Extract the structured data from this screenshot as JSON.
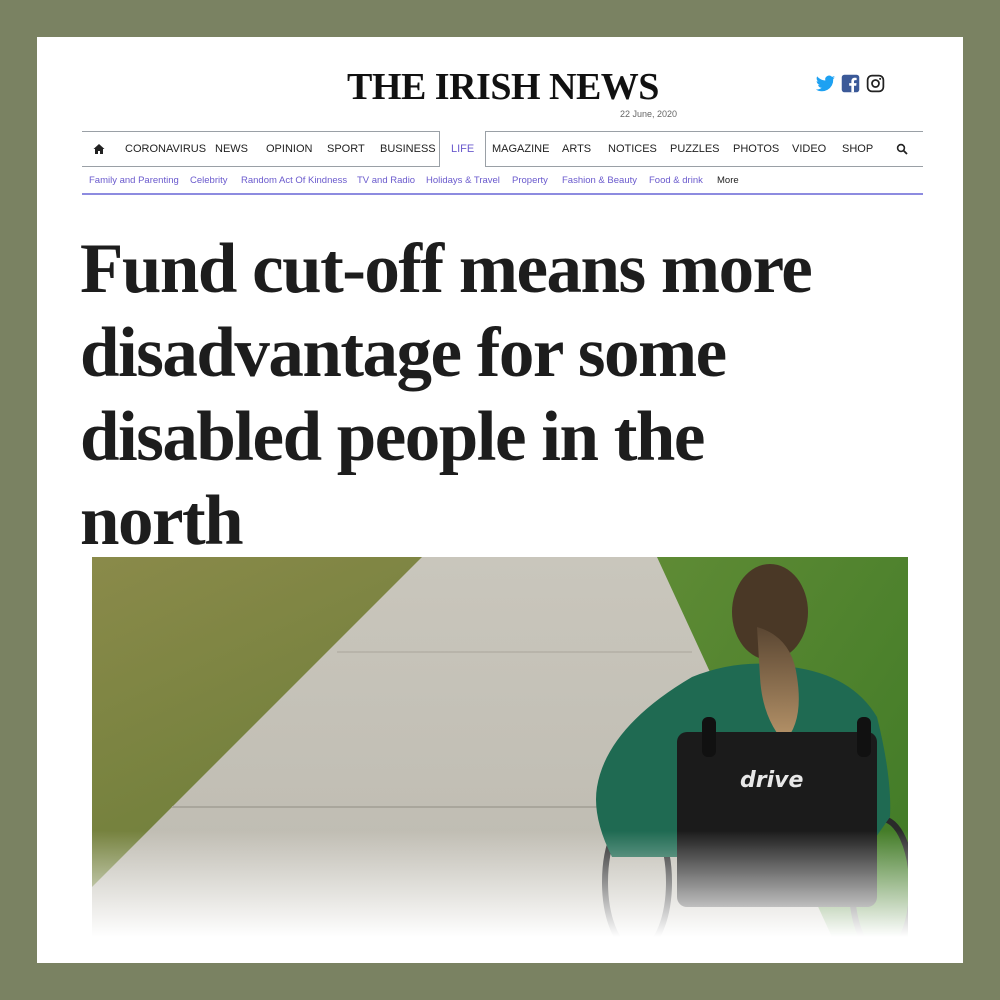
{
  "site": {
    "name": "THE IRISH NEWS",
    "date": "22 June, 2020"
  },
  "social": [
    "twitter-icon",
    "facebook-icon",
    "instagram-icon"
  ],
  "main_nav": {
    "items": [
      "CORONAVIRUS",
      "NEWS",
      "OPINION",
      "SPORT",
      "BUSINESS",
      "LIFE",
      "MAGAZINE",
      "ARTS",
      "NOTICES",
      "PUZZLES",
      "PHOTOS",
      "VIDEO",
      "SHOP"
    ],
    "active": "LIFE"
  },
  "sub_nav": {
    "items": [
      "Family and Parenting",
      "Celebrity",
      "Random Act Of Kindness",
      "TV and Radio",
      "Holidays & Travel",
      "Property",
      "Fashion & Beauty",
      "Food & drink",
      "More"
    ]
  },
  "article": {
    "headline_lines": [
      "Fund cut-off means more",
      "disadvantage for some",
      "disabled people in the",
      "north"
    ],
    "photo_brand_text": "drive"
  },
  "colors": {
    "frame": "#7a8262",
    "accent": "#6a5acd",
    "subnav_rule": "#8d8be0",
    "headline": "#1d1d1d"
  }
}
